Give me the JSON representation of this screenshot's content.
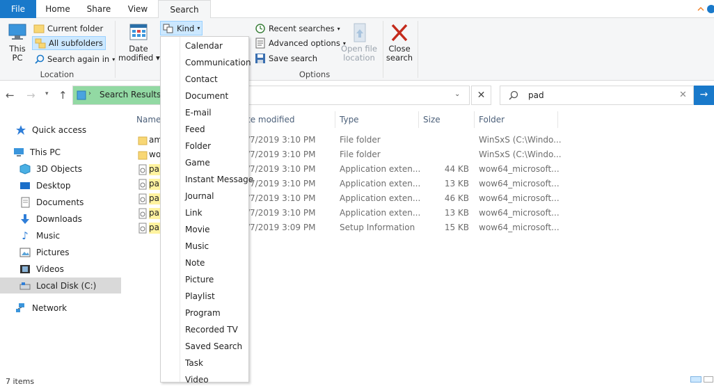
{
  "tabs": [
    {
      "label": "File"
    },
    {
      "label": "Home"
    },
    {
      "label": "Share"
    },
    {
      "label": "View"
    },
    {
      "label": "Search"
    }
  ],
  "ribbon": {
    "this_pc": {
      "line1": "This",
      "line2": "PC"
    },
    "current_folder": "Current folder",
    "all_subfolders": "All subfolders",
    "search_again_in": "Search again in",
    "location_group": "Location",
    "date_modified": {
      "line1": "Date",
      "line2": "modified"
    },
    "kind": "Kind",
    "recent_searches": "Recent searches",
    "advanced_options": "Advanced options",
    "save_search": "Save search",
    "open_file_location": {
      "line1": "Open file",
      "line2": "location"
    },
    "close_search": {
      "line1": "Close",
      "line2": "search"
    },
    "options_group": "Options"
  },
  "address": {
    "path": "Search Results in",
    "search_value": "pad"
  },
  "nav": {
    "quick_access": "Quick access",
    "this_pc": "This PC",
    "objects_3d": "3D Objects",
    "desktop": "Desktop",
    "documents": "Documents",
    "downloads": "Downloads",
    "music": "Music",
    "pictures": "Pictures",
    "videos": "Videos",
    "local_disk": "Local Disk (C:)",
    "network": "Network"
  },
  "columns": {
    "name": "Name",
    "date_modified": "te modified",
    "type": "Type",
    "size": "Size",
    "folder": "Folder"
  },
  "rows": [
    {
      "name": "am",
      "date": "/7/2019 3:10 PM",
      "type": "File folder",
      "size": "",
      "folder": "WinSxS (C:\\Windo..."
    },
    {
      "name": "wo",
      "date": "/7/2019 3:10 PM",
      "type": "File folder",
      "size": "",
      "folder": "WinSxS (C:\\Windo..."
    },
    {
      "name": "pa",
      "date": "/7/2019 3:10 PM",
      "type": "Application exten...",
      "size": "44 KB",
      "folder": "wow64_microsoft..."
    },
    {
      "name": "pa",
      "date": "/7/2019 3:10 PM",
      "type": "Application exten...",
      "size": "13 KB",
      "folder": "wow64_microsoft..."
    },
    {
      "name": "pa",
      "date": "/7/2019 3:10 PM",
      "type": "Application exten...",
      "size": "46 KB",
      "folder": "wow64_microsoft..."
    },
    {
      "name": "pa",
      "date": "/7/2019 3:10 PM",
      "type": "Application exten...",
      "size": "13 KB",
      "folder": "wow64_microsoft..."
    },
    {
      "name": "pa",
      "date": "/7/2019 3:09 PM",
      "type": "Setup Information",
      "size": "15 KB",
      "folder": "wow64_microsoft..."
    }
  ],
  "kind_menu": [
    "Calendar",
    "Communication",
    "Contact",
    "Document",
    "E-mail",
    "Feed",
    "Folder",
    "Game",
    "Instant Message",
    "Journal",
    "Link",
    "Movie",
    "Music",
    "Note",
    "Picture",
    "Playlist",
    "Program",
    "Recorded TV",
    "Saved Search",
    "Task",
    "Video"
  ],
  "status": {
    "items": "7 items"
  },
  "colors": {
    "file_tab": "#1979ca",
    "selected_btn": "#cce8ff",
    "highlight": "#fff3a0",
    "search_green": "#92d9a3",
    "go_button": "#1979ca"
  }
}
